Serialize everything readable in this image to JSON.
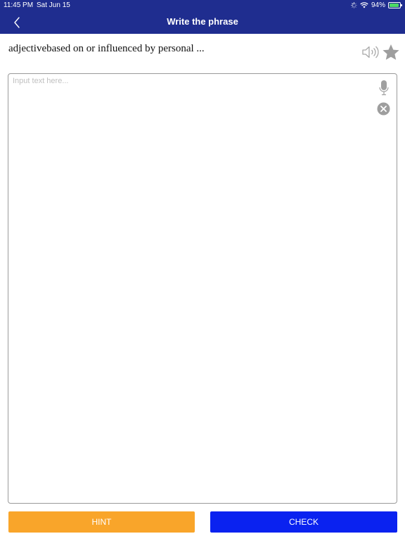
{
  "status_bar": {
    "time": "11:45 PM",
    "date": "Sat Jun 15",
    "battery_text": "94%",
    "battery_level": 0.94
  },
  "nav": {
    "title": "Write the phrase",
    "back_icon": "chevron-left-icon"
  },
  "prompt": {
    "text": "adjectivebased on or influenced by personal ...",
    "speaker_icon": "speaker-icon",
    "star_icon": "star-icon"
  },
  "answer": {
    "placeholder": "Input text here...",
    "value": "",
    "mic_icon": "microphone-icon",
    "clear_icon": "clear-icon"
  },
  "actions": {
    "hint_label": "HINT",
    "check_label": "CHECK"
  },
  "colors": {
    "header": "#1f2d8f",
    "hint": "#f9a52a",
    "check": "#0a22f0",
    "icon_gray": "#9e9e9e"
  }
}
